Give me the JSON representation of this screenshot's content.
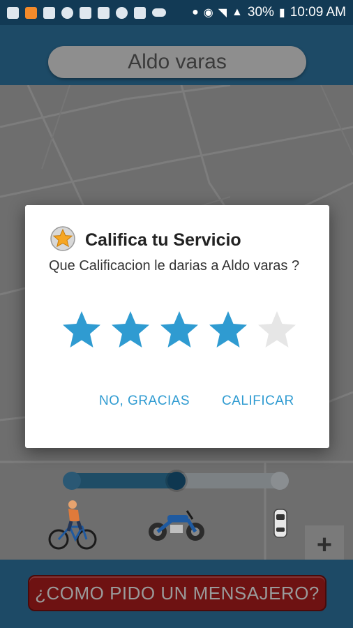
{
  "status_bar": {
    "battery": "30%",
    "time": "10:09 AM",
    "icons": [
      "gallery-icon",
      "app-icon",
      "mail-icon",
      "app-icon",
      "photo-icon",
      "image-icon",
      "instagram-icon",
      "rx-icon",
      "cloud-icon"
    ],
    "right_icons": [
      "location-icon",
      "alarm-icon",
      "wifi-icon",
      "signal-icon",
      "battery-icon"
    ]
  },
  "header": {
    "courier_name": "Aldo varas"
  },
  "dialog": {
    "title": "Califica tu Servicio",
    "message": "Que Calificacion le darias a Aldo varas ?",
    "rating": 4,
    "max_rating": 5,
    "star_color": "#2f9bd1",
    "star_empty_color": "#e6e6e6",
    "cancel_label": "NO, GRACIAS",
    "confirm_label": "CALIFICAR"
  },
  "vehicles": {
    "selected_index": 1,
    "options": [
      "bicycle-icon",
      "motorcycle-icon",
      "car-icon"
    ]
  },
  "map": {
    "zoom_in_label": "+"
  },
  "footer": {
    "cta_label": "¿COMO PIDO UN MENSAJERO?"
  }
}
